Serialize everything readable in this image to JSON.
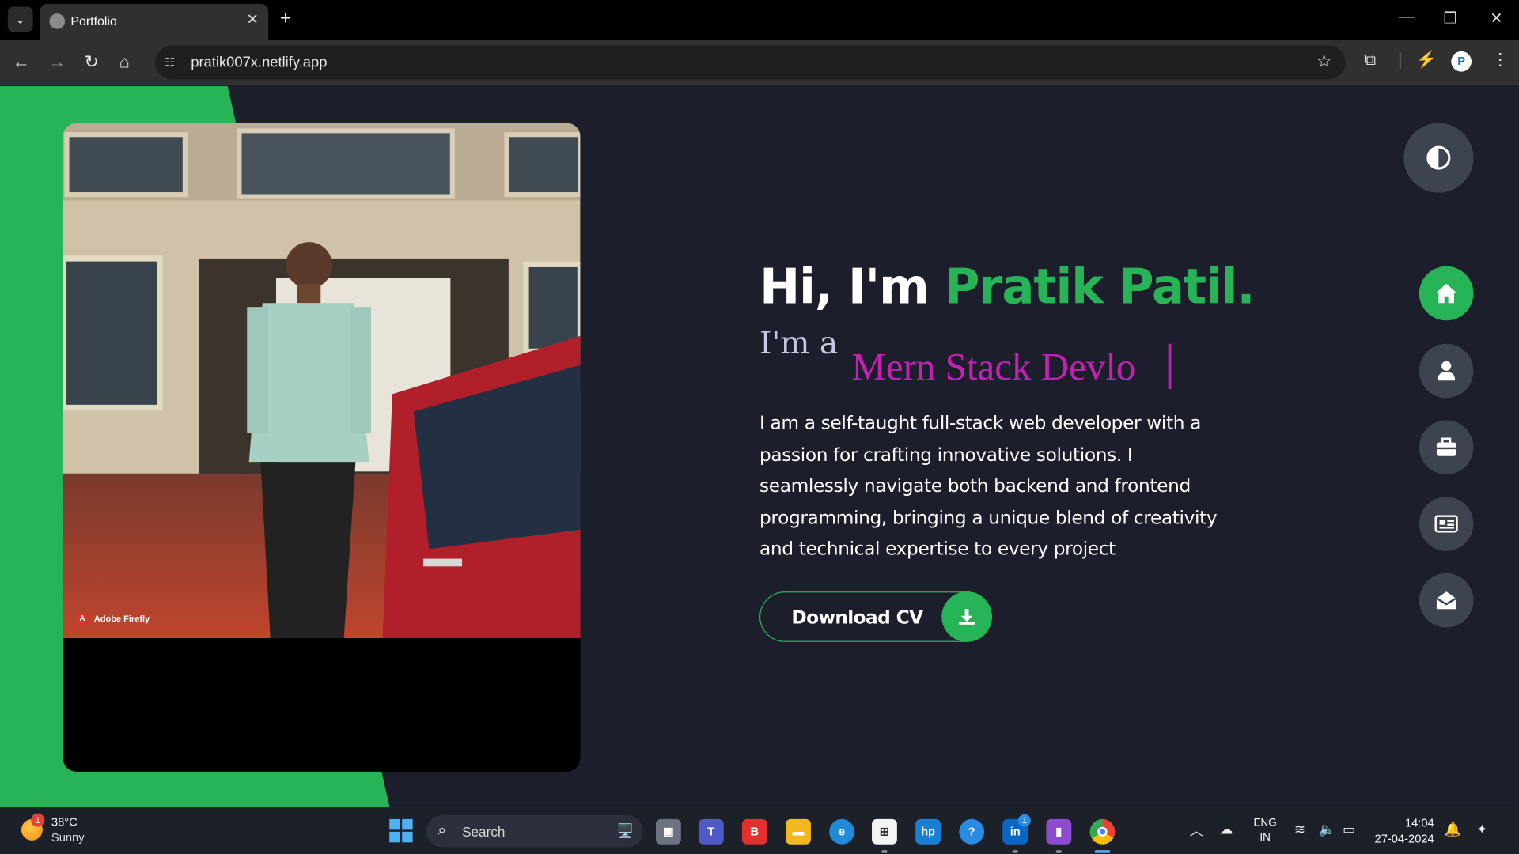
{
  "browser": {
    "tab_title": "Portfolio",
    "url": "pratik007x.netlify.app",
    "profile_initial": "P",
    "tab_close": "✕",
    "new_tab": "+"
  },
  "hero": {
    "greeting_prefix": "Hi, I'm ",
    "name": "Pratik Patil.",
    "role_prefix": "I'm a",
    "role_typed": "Mern Stack Devlo",
    "bio": "I am a self-taught full-stack web developer with a passion for crafting innovative solutions. I seamlessly navigate both backend and frontend programming, bringing a unique blend of creativity and technical expertise to every project",
    "cv_button": "Download CV",
    "photo_watermark": "Adobe Firefly",
    "accent_color": "#26b457",
    "typed_color": "#c71fb3"
  },
  "side_nav": {
    "items": [
      {
        "icon": "home-icon",
        "active": true
      },
      {
        "icon": "user-icon",
        "active": false
      },
      {
        "icon": "briefcase-icon",
        "active": false
      },
      {
        "icon": "newspaper-icon",
        "active": false
      },
      {
        "icon": "envelope-open-icon",
        "active": false
      }
    ]
  },
  "taskbar": {
    "temperature": "38°C",
    "weather": "Sunny",
    "weather_badge": "1",
    "search_placeholder": "Search",
    "language_line1": "ENG",
    "language_line2": "IN",
    "time": "14:04",
    "date": "27-04-2024",
    "linkedin_badge": "1"
  }
}
